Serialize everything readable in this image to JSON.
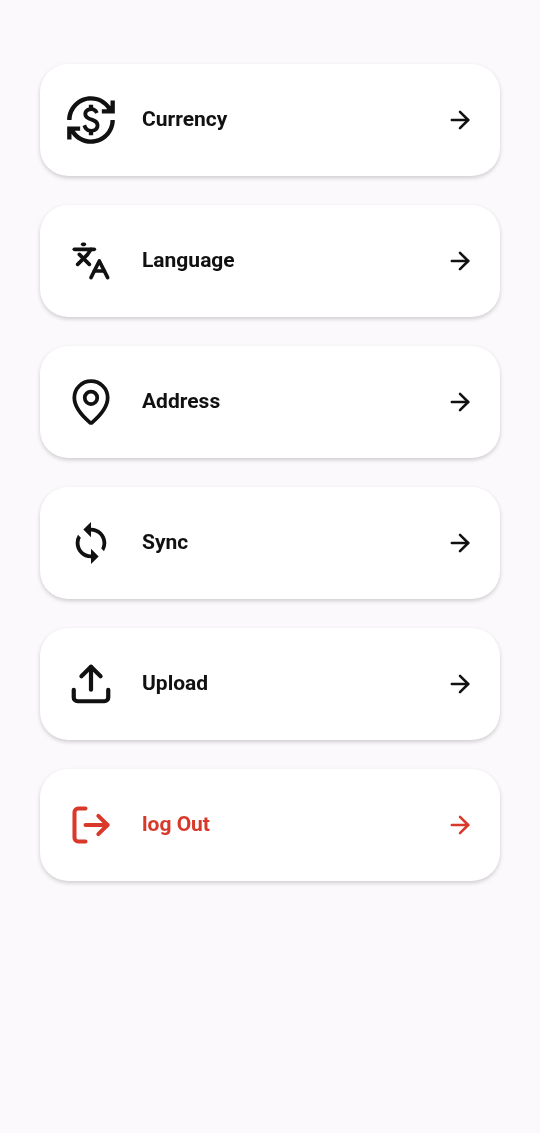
{
  "menu": [
    {
      "label": "Currency",
      "kind": "default"
    },
    {
      "label": "Language",
      "kind": "default"
    },
    {
      "label": "Address",
      "kind": "default"
    },
    {
      "label": "Sync",
      "kind": "default"
    },
    {
      "label": "Upload",
      "kind": "default"
    },
    {
      "label": "log Out",
      "kind": "danger"
    }
  ]
}
